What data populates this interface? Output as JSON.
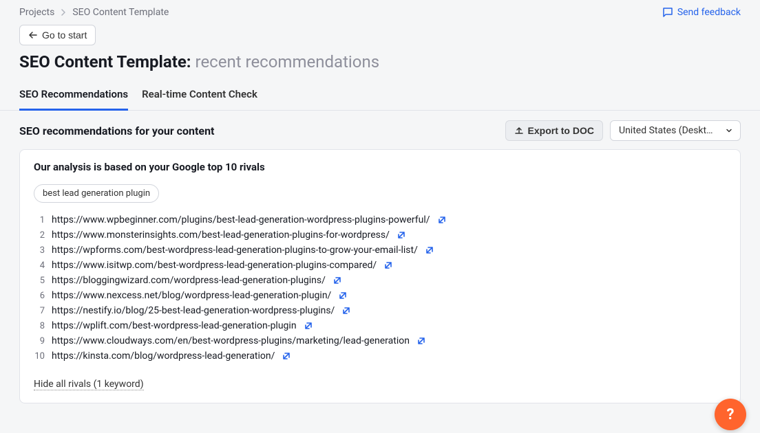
{
  "breadcrumbs": {
    "projects": "Projects",
    "current": "SEO Content Template"
  },
  "feedback_label": "Send feedback",
  "go_to_start_label": "Go to start",
  "page_title_prefix": "SEO Content Template:",
  "page_title_sub": "recent recommendations",
  "tabs": {
    "seo": "SEO Recommendations",
    "realtime": "Real-time Content Check"
  },
  "section_title": "SEO recommendations for your content",
  "export_label": "Export to DOC",
  "region_label": "United States (Deskt…",
  "card_title": "Our analysis is based on your Google top 10 rivals",
  "keyword_pill": "best lead generation plugin",
  "rivals": [
    "https://www.wpbeginner.com/plugins/best-lead-generation-wordpress-plugins-powerful/",
    "https://www.monsterinsights.com/best-lead-generation-plugins-for-wordpress/",
    "https://wpforms.com/best-wordpress-lead-generation-plugins-to-grow-your-email-list/",
    "https://www.isitwp.com/best-wordpress-lead-generation-plugins-compared/",
    "https://bloggingwizard.com/wordpress-lead-generation-plugins/",
    "https://www.nexcess.net/blog/wordpress-lead-generation-plugin/",
    "https://nestify.io/blog/25-best-lead-generation-wordpress-plugins/",
    "https://wplift.com/best-wordpress-lead-generation-plugin",
    "https://www.cloudways.com/en/best-wordpress-plugins/marketing/lead-generation",
    "https://kinsta.com/blog/wordpress-lead-generation/"
  ],
  "hide_rivals_label": "Hide all rivals (1 keyword)",
  "help_symbol": "?"
}
